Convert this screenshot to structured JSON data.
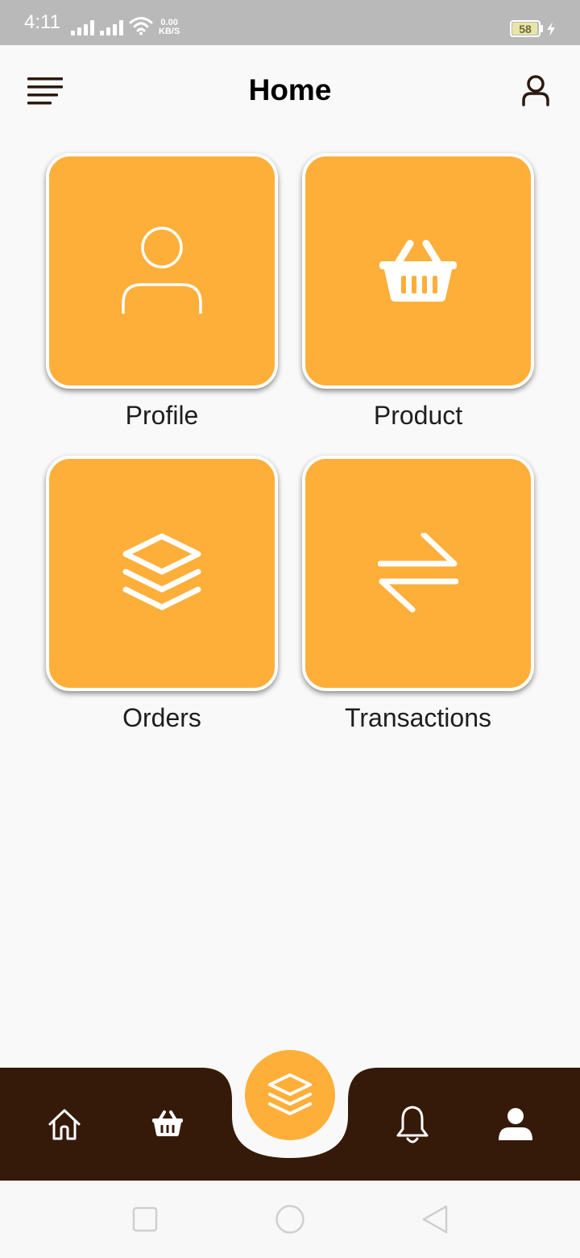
{
  "status_bar": {
    "time": "4:11",
    "net_speed_value": "0.00",
    "net_speed_unit": "KB/S",
    "battery_level": "58"
  },
  "header": {
    "title": "Home",
    "menu_icon": "menu-icon",
    "account_icon": "user-outline-icon"
  },
  "tiles": [
    {
      "label": "Profile",
      "icon": "user-outline-icon"
    },
    {
      "label": "Product",
      "icon": "basket-icon"
    },
    {
      "label": "Orders",
      "icon": "layers-icon"
    },
    {
      "label": "Transactions",
      "icon": "swap-arrows-icon"
    }
  ],
  "bottom_nav": {
    "items": [
      {
        "icon": "home-icon"
      },
      {
        "icon": "basket-icon"
      },
      {
        "icon": "layers-icon",
        "active": true
      },
      {
        "icon": "bell-icon"
      },
      {
        "icon": "user-filled-icon"
      }
    ]
  },
  "android_nav": {
    "buttons": [
      "recents-icon",
      "home-circle-icon",
      "back-icon"
    ]
  },
  "colors": {
    "accent": "#fdaf3a",
    "nav_background": "#351a09",
    "status_bar": "#b9b9b9",
    "background": "#f9f9f9",
    "header_icon": "#2b1a10"
  }
}
